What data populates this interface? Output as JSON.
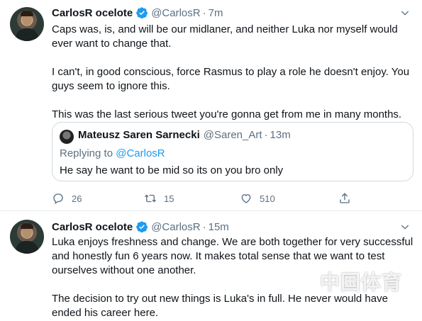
{
  "tweets": [
    {
      "author_name": "CarlosR ocelote",
      "handle": "@CarlosR",
      "separator": "·",
      "time": "7m",
      "paragraphs": [
        "Caps was, is, and will be our midlaner, and neither Luka nor myself would ever want to change that.",
        "I can't, in good conscious, force Rasmus to play a role he doesn't enjoy. You guys seem to ignore this.",
        "This was the last serious tweet you're gonna get from me in many months."
      ],
      "quote": {
        "author_name": "Mateusz Saren Sarnecki",
        "handle": "@Saren_Art",
        "separator": "·",
        "time": "13m",
        "replying_prefix": "Replying to ",
        "replying_to": "@CarlosR",
        "text": "He say he want to be mid so its on you bro only"
      },
      "actions": {
        "reply_count": "26",
        "retweet_count": "15",
        "like_count": "510"
      }
    },
    {
      "author_name": "CarlosR ocelote",
      "handle": "@CarlosR",
      "separator": "·",
      "time": "15m",
      "paragraphs": [
        "Luka enjoys freshness and change. We are both together for very successful and honestly fun 6 years now. It makes total sense that we want to test ourselves without one another.",
        "The decision to try out new things is Luka's in full. He never would have ended his career here."
      ]
    }
  ],
  "watermark": {
    "text": "中国体育"
  },
  "colors": {
    "verified": "#1d9bf0",
    "secondary_text": "#5b7083",
    "link": "#1d9bf0",
    "border": "#cfd9de"
  }
}
